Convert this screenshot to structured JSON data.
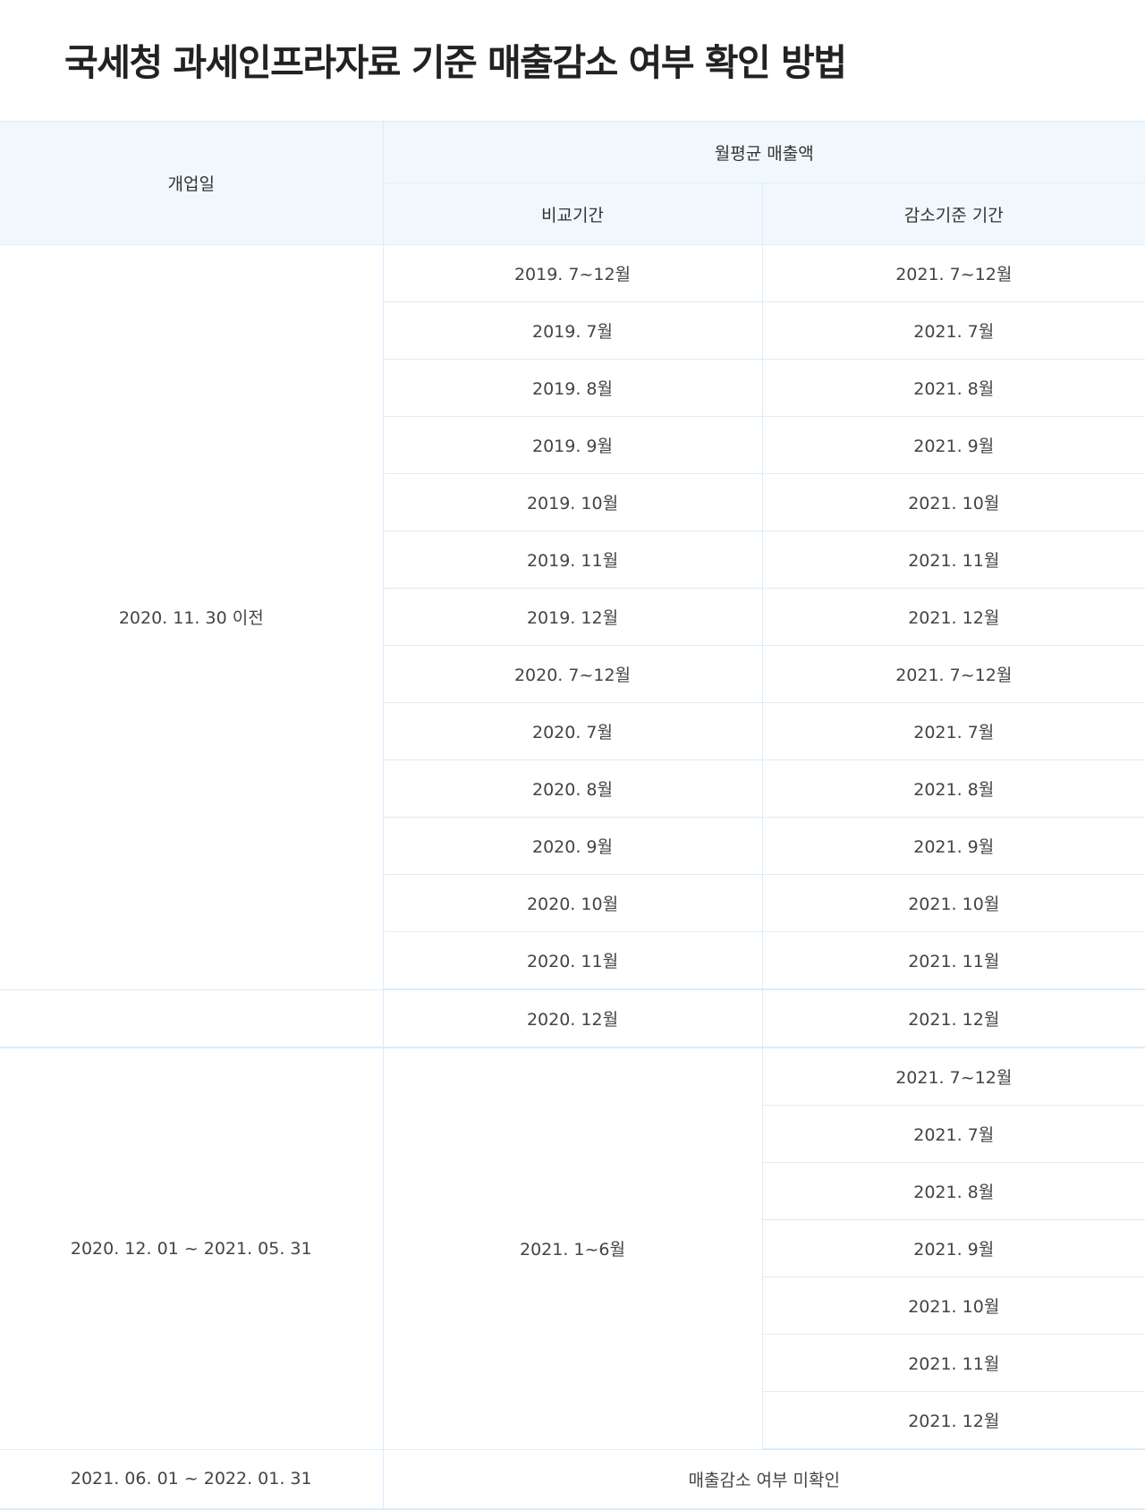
{
  "title": "국세청 과세인프라자료 기준 매출감소 여부 확인 방법",
  "header": {
    "opening_date": "개업일",
    "monthly_avg_sales": "월평균 매출액",
    "comparison_period": "비교기간",
    "reduction_period": "감소기준 기간"
  },
  "group1": {
    "opening": "2020. 11. 30 이전",
    "rows": [
      {
        "compare": "2019. 7~12월",
        "reduce": "2021. 7~12월"
      },
      {
        "compare": "2019. 7월",
        "reduce": "2021. 7월"
      },
      {
        "compare": "2019. 8월",
        "reduce": "2021. 8월"
      },
      {
        "compare": "2019. 9월",
        "reduce": "2021. 9월"
      },
      {
        "compare": "2019. 10월",
        "reduce": "2021. 10월"
      },
      {
        "compare": "2019. 11월",
        "reduce": "2021. 11월"
      },
      {
        "compare": "2019. 12월",
        "reduce": "2021. 12월"
      },
      {
        "compare": "2020. 7~12월",
        "reduce": "2021. 7~12월"
      },
      {
        "compare": "2020. 7월",
        "reduce": "2021. 7월"
      },
      {
        "compare": "2020. 8월",
        "reduce": "2021. 8월"
      },
      {
        "compare": "2020. 9월",
        "reduce": "2021. 9월"
      },
      {
        "compare": "2020. 10월",
        "reduce": "2021. 10월"
      },
      {
        "compare": "2020. 11월",
        "reduce": "2021. 11월"
      }
    ]
  },
  "group2": {
    "opening": "",
    "compare": "2020. 12월",
    "reduce": "2021. 12월"
  },
  "group3": {
    "opening": "2020. 12. 01 ~ 2021. 05. 31",
    "compare": "2021. 1~6월",
    "reduce": [
      "2021. 7~12월",
      "2021. 7월",
      "2021. 8월",
      "2021. 9월",
      "2021. 10월",
      "2021. 11월",
      "2021. 12월"
    ]
  },
  "group4": {
    "opening": "2021. 06. 01 ~ 2022. 01. 31",
    "note": "매출감소 여부 미확인"
  }
}
